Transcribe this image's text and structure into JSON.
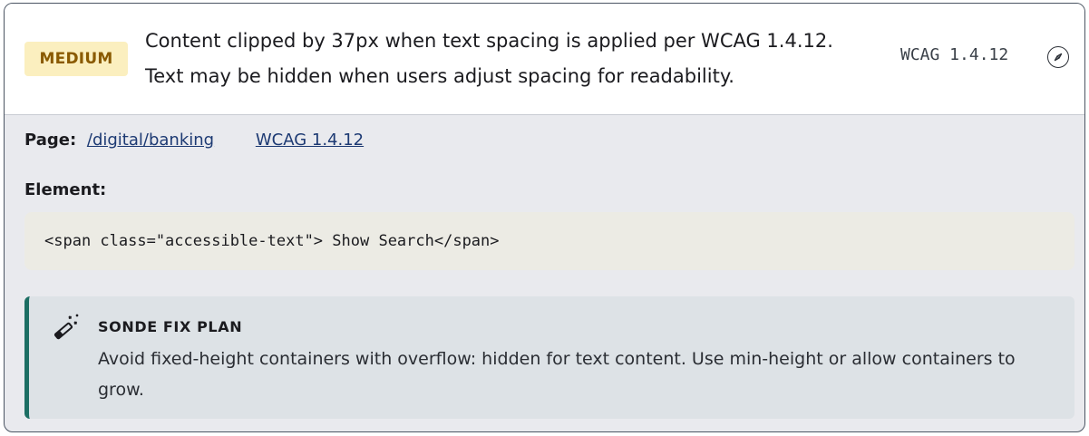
{
  "issue": {
    "severity": "MEDIUM",
    "summary": "Content clipped by 37px when text spacing is applied per WCAG 1.4.12. Text may be hidden when users adjust spacing for readability.",
    "criterion": "WCAG 1.4.12",
    "criterion_icon": "compass-icon"
  },
  "details": {
    "page_label": "Page:",
    "page_link": "/digital/banking",
    "wcag_link": "WCAG 1.4.12",
    "element_label": "Element:",
    "element_code": "<span class=\"accessible-text\"> Show Search</span>"
  },
  "fix_plan": {
    "title": "SONDE FIX PLAN",
    "icon": "magic-wand-icon",
    "text": "Avoid fixed-height containers with overflow: hidden for text content. Use min-height or allow containers to grow."
  },
  "colors": {
    "severity_bg": "#fbefbf",
    "severity_text": "#8a5a00",
    "fix_accent": "#1c6e63",
    "link": "#1d3a73"
  }
}
